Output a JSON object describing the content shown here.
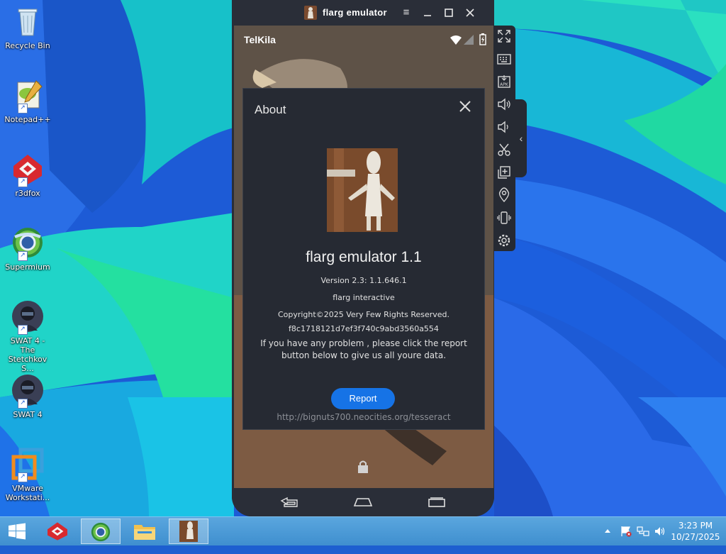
{
  "desktop": {
    "icons": [
      {
        "label": "Recycle Bin"
      },
      {
        "label": "Notepad++"
      },
      {
        "label": "r3dfox"
      },
      {
        "label": "Supermium"
      },
      {
        "label": "SWAT 4 - The Stetchkov S..."
      },
      {
        "label": "SWAT 4"
      },
      {
        "label": "VMware Workstati..."
      }
    ]
  },
  "emulator": {
    "title": "flarg emulator",
    "controls": [
      "menu-icon",
      "minimize-icon",
      "maximize-icon",
      "close-icon"
    ],
    "status_bar": {
      "carrier": "TelKila"
    },
    "side_toolbar": [
      "fullscreen-icon",
      "keyboard-icon",
      "apk-install-icon",
      "volume-up-icon",
      "volume-down-icon",
      "screenshot-scissors-icon",
      "multi-instance-icon",
      "location-icon",
      "shake-icon",
      "settings-icon"
    ],
    "nav": [
      "back-icon",
      "home-icon",
      "recents-icon"
    ]
  },
  "about": {
    "title": "About",
    "app_name": "flarg emulator 1.1",
    "version": "Version 2.3: 1.1.646.1",
    "company": "flarg interactive",
    "copyright": "Copyright©2025 Very Few Rights Reserved.",
    "hash": "f8c1718121d7ef3f740c9abd3560a554",
    "message_line1": "If you have any problem , please click the report",
    "message_line2": "button below to give us all youre data.",
    "report_label": "Report",
    "url": "http://bignuts700.neocities.org/tesseract"
  },
  "taskbar": {
    "items": [
      "r3dfox",
      "Supermium",
      "File Explorer",
      "flarg emulator"
    ],
    "tray_icons": [
      "chevron-up-icon",
      "action-center-flag-icon",
      "network-icon",
      "speaker-icon"
    ],
    "time": "3:23 PM",
    "date": "10/27/2025"
  },
  "colors": {
    "accent": "#1673e6",
    "dialog_bg": "#262a33",
    "taskbar": "#4a9bd6"
  }
}
